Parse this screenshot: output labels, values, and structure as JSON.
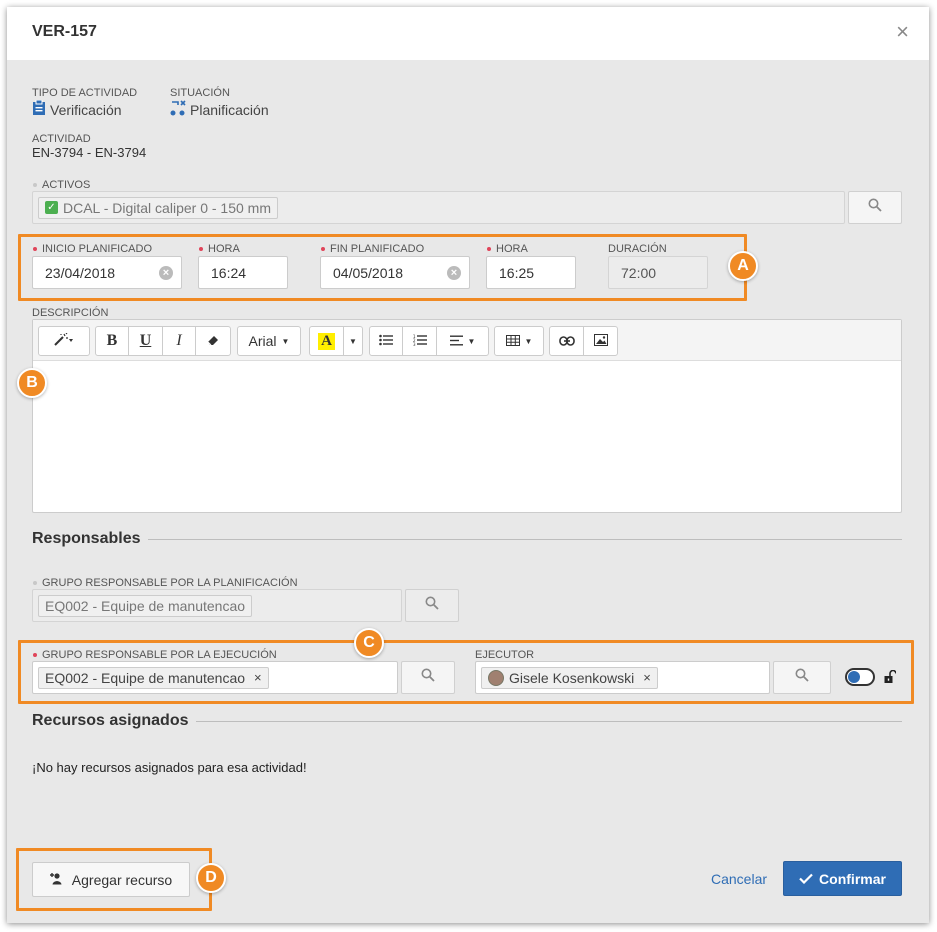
{
  "dialog": {
    "title": "VER-157",
    "close_symbol": "×"
  },
  "info": {
    "activity_type_label": "TIPO DE ACTIVIDAD",
    "activity_type_value": "Verificación",
    "status_label": "SITUACIÓN",
    "status_value": "Planificación",
    "activity_label": "ACTIVIDAD",
    "activity_value": "EN-3794 - EN-3794"
  },
  "assets": {
    "label": "ACTIVOS",
    "tag": "DCAL - Digital caliper 0 - 150 mm"
  },
  "schedule": {
    "start_label": "INICIO PLANIFICADO",
    "start_value": "23/04/2018",
    "start_time_label": "HORA",
    "start_time_value": "16:24",
    "end_label": "FIN PLANIFICADO",
    "end_value": "04/05/2018",
    "end_time_label": "HORA",
    "end_time_value": "16:25",
    "duration_label": "DURACIÓN",
    "duration_value": "72:00"
  },
  "description": {
    "label": "DESCRIPCIÓN",
    "toolbar": {
      "bold": "B",
      "underline": "U",
      "italic": "I",
      "font": "Arial",
      "highlight": "A"
    },
    "content": ""
  },
  "responsibles": {
    "section_title": "Responsables",
    "planning_group_label": "GRUPO RESPONSABLE POR LA PLANIFICACIÓN",
    "planning_group_value": "EQ002 - Equipe de manutencao",
    "execution_group_label": "GRUPO RESPONSABLE POR LA EJECUCIÓN",
    "execution_group_value": "EQ002 - Equipe de manutencao",
    "executor_label": "EJECUTOR",
    "executor_value": "Gisele Kosenkowski",
    "remove_symbol": "×"
  },
  "resources": {
    "section_title": "Recursos asignados",
    "empty_message": "¡No hay recursos asignados para esa actividad!"
  },
  "footer": {
    "add_resource_label": "Agregar recurso",
    "cancel_label": "Cancelar",
    "confirm_label": "Confirmar"
  },
  "markers": {
    "a": "A",
    "b": "B",
    "c": "C",
    "d": "D"
  },
  "colors": {
    "accent": "#2f6db5",
    "highlight": "#f08a24",
    "required_dot": "#e0455a",
    "background": "#e8e8e8"
  }
}
